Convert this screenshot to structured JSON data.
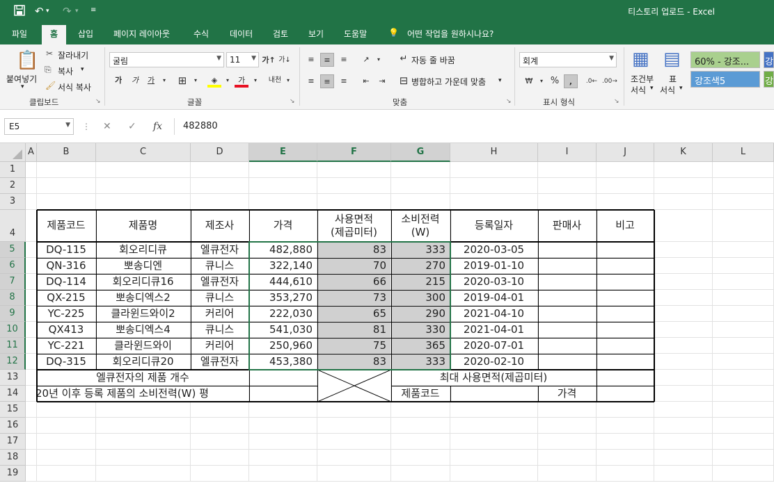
{
  "window": {
    "title": "티스토리 업로드  -  Excel"
  },
  "tabs": [
    "파일",
    "홈",
    "삽입",
    "페이지 레이아웃",
    "수식",
    "데이터",
    "검토",
    "보기",
    "도움말"
  ],
  "tell_me": "어떤 작업을 원하시나요?",
  "ribbon": {
    "paste": "붙여넣기",
    "cut": "잘라내기",
    "copy": "복사",
    "format_painter": "서식 복사",
    "clipboard": "클립보드",
    "font_name": "굴림",
    "font_size": "11",
    "font_group": "글꼴",
    "wrap_text": "자동 줄 바꿈",
    "merge_center": "병합하고 가운데 맞춤",
    "align_group": "맞춤",
    "number_format": "회계",
    "number_group": "표시 형식",
    "cond_format_1": "조건부",
    "cond_format_2": "서식",
    "table_format_1": "표",
    "table_format_2": "서식",
    "style_1": "60% - 강조...",
    "style_2": "강조색5",
    "style_3": "강"
  },
  "formula_bar": {
    "name_box": "E5",
    "formula": "482880"
  },
  "columns": [
    "A",
    "B",
    "C",
    "D",
    "E",
    "F",
    "G",
    "H",
    "I",
    "J",
    "K",
    "L"
  ],
  "rows": [
    "1",
    "2",
    "3",
    "4",
    "5",
    "6",
    "7",
    "8",
    "9",
    "10",
    "11",
    "12",
    "13",
    "14",
    "15",
    "16",
    "17",
    "18",
    "19"
  ],
  "table": {
    "headers": [
      "제품코드",
      "제품명",
      "제조사",
      "가격",
      "사용면적\n(제곱미터)",
      "소비전력\n(W)",
      "등록일자",
      "판매사",
      "비고"
    ],
    "rows": [
      [
        "DQ-115",
        "회오리디큐",
        "엘큐전자",
        "482,880",
        "83",
        "333",
        "2020-03-05",
        "",
        ""
      ],
      [
        "QN-316",
        "뽀송디엔",
        "큐니스",
        "322,140",
        "70",
        "270",
        "2019-01-10",
        "",
        ""
      ],
      [
        "DQ-114",
        "회오리디큐16",
        "엘큐전자",
        "444,610",
        "66",
        "215",
        "2020-03-10",
        "",
        ""
      ],
      [
        "QX-215",
        "뽀송디엑스2",
        "큐니스",
        "353,270",
        "73",
        "300",
        "2019-04-01",
        "",
        ""
      ],
      [
        "YC-225",
        "클라윈드와이2",
        "커리어",
        "222,030",
        "65",
        "290",
        "2021-04-10",
        "",
        ""
      ],
      [
        "QX413",
        "뽀송디엑스4",
        "큐니스",
        "541,030",
        "81",
        "330",
        "2021-04-01",
        "",
        ""
      ],
      [
        "YC-221",
        "클라윈드와이",
        "커리어",
        "250,960",
        "75",
        "365",
        "2020-07-01",
        "",
        ""
      ],
      [
        "DQ-315",
        "회오리디큐20",
        "엘큐전자",
        "453,380",
        "83",
        "333",
        "2020-02-10",
        "",
        ""
      ]
    ],
    "summary": {
      "r13_label": "엘큐전자의 제품 개수",
      "r14_label": "20년 이후 등록 제품의 소비전력(W) 평",
      "max_area_label": "최대 사용면적(제곱미터)",
      "product_code_label": "제품코드",
      "price_label": "가격"
    }
  }
}
